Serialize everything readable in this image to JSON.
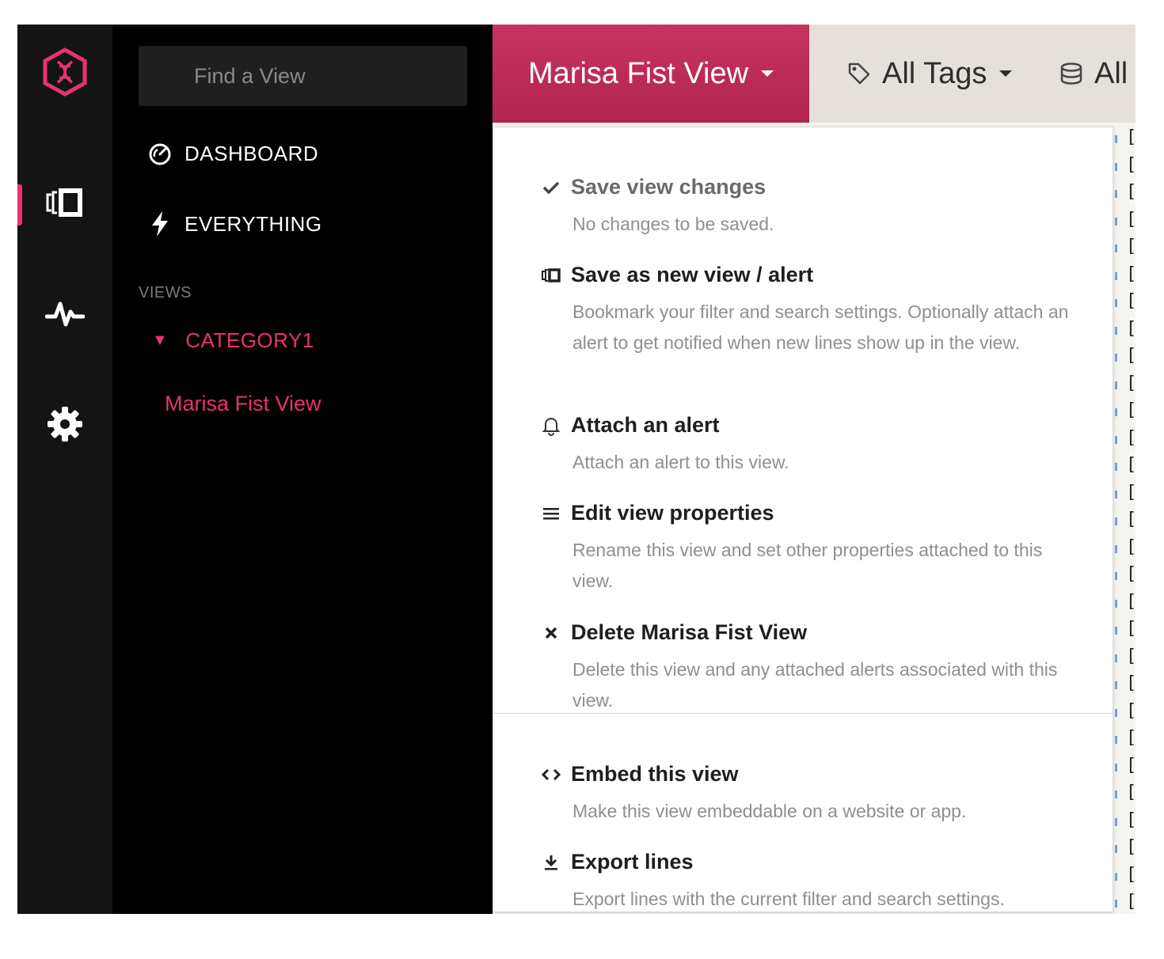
{
  "sidebar": {
    "search_placeholder": "Find a View",
    "links": [
      {
        "label": "DASHBOARD",
        "icon": "gauge-icon"
      },
      {
        "label": "EVERYTHING",
        "icon": "lightning-icon"
      }
    ],
    "views_heading": "VIEWS",
    "category": {
      "label": "CATEGORY1",
      "toggle": "▼"
    },
    "view_item": "Marisa Fist View"
  },
  "topbar": {
    "view_button": "Marisa Fist View",
    "tags_button": "All Tags",
    "sources_button": "All"
  },
  "menu": {
    "items": [
      {
        "title": "Save view changes",
        "desc": "No changes to be saved.",
        "icon": "check-icon"
      },
      {
        "title": "Save as new view / alert",
        "desc": "Bookmark your filter and search settings. Optionally attach an alert to get notified when new lines show up in the view.",
        "icon": "view-icon"
      },
      {
        "title": "Attach an alert",
        "desc": "Attach an alert to this view.",
        "icon": "bell-icon"
      },
      {
        "title": "Edit view properties",
        "desc": "Rename this view and set other properties attached to this view.",
        "icon": "menu-lines-icon"
      },
      {
        "title": "Delete Marisa Fist View",
        "desc": "Delete this view and any attached alerts associated with this view.",
        "icon": "close-icon"
      },
      {
        "title": "Embed this view",
        "desc": "Make this view embeddable on a website or app.",
        "icon": "code-icon"
      },
      {
        "title": "Export lines",
        "desc": "Export lines with the current filter and search settings.",
        "icon": "download-icon"
      }
    ]
  },
  "colors": {
    "accent": "#e8336e",
    "view_button": "#c12c5a",
    "rail_bg": "#141414",
    "topbar_bg": "#e5e1da"
  }
}
